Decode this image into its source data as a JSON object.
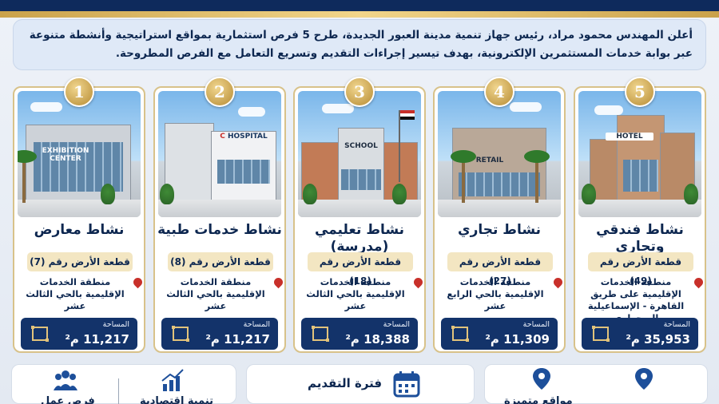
{
  "intro": {
    "line1": "أعلن المهندس محمود مراد، رئيس جهاز تنمية مدينة العبور الجديدة، طرح 5 فرص استثمارية بمواقع استراتيجية وأنشطة متنوعة",
    "line2": "عبر بوابة خدمات المستثمرين الإلكترونية، بهدف تيسير إجراءات التقديم وتسريع التعامل مع الفرص المطروحة."
  },
  "cards": [
    {
      "num": "1",
      "sign": "EXHIBITION\nCENTER",
      "title": "نشاط معارض",
      "plot": "قطعة الأرض رقم (7)",
      "loc": "منطقة الخدمات الإقليمية بالحي الثالث عشر",
      "area_label": "المساحة",
      "area": "11,217 م²"
    },
    {
      "num": "2",
      "sign": "HOSPITAL",
      "title": "نشاط خدمات طبية",
      "plot": "قطعة الأرض رقم (8)",
      "loc": "منطقة الخدمات الإقليمية بالحي الثالث عشر",
      "area_label": "المساحة",
      "area": "11,217 م²"
    },
    {
      "num": "3",
      "sign": "SCHOOL",
      "title": "نشاط تعليمي (مدرسة)",
      "plot": "قطعة الأرض رقم (18)",
      "loc": "منطقة الخدمات الإقليمية بالحي الثالث عشر",
      "area_label": "المساحة",
      "area": "18,388 م²"
    },
    {
      "num": "4",
      "sign": "RETAIL",
      "title": "نشاط تجاري",
      "plot": "قطعة الأرض رقم (27)",
      "loc": "منطقة الخدمات الإقليمية بالحي الرابع عشر",
      "area_label": "المساحة",
      "area": "11,309 م²"
    },
    {
      "num": "5",
      "sign": "HOTEL",
      "title": "نشاط فندقي وتجاري",
      "plot": "قطعة الأرض رقم (49)",
      "loc": "منطقة الخدمات الإقليمية على طريق القاهرة - الإسماعيلية الصحراوي",
      "area_label": "المساحة",
      "area": "35,953 م²"
    }
  ],
  "bottom": {
    "left_a": "فرص عمل",
    "left_b": "تنمية اقتصادية",
    "middle": "فترة التقديم",
    "right": "مواقع متميزة"
  },
  "colors": {
    "navy": "#0d2750",
    "gold": "#caa24a",
    "pin": "#c8302a"
  }
}
